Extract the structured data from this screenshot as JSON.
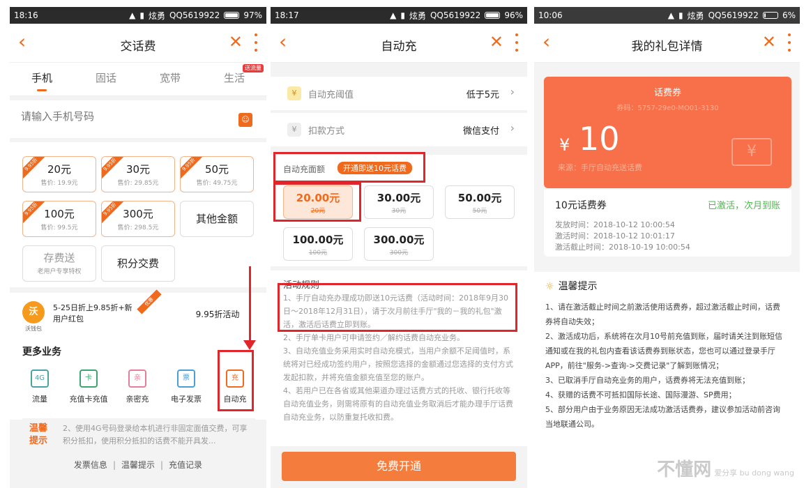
{
  "panel1": {
    "status": {
      "time": "18:16",
      "wifi": "WiFi",
      "signal": "炫勇",
      "carrier": "QQ5619922",
      "battery": "97%",
      "battery_level": 0.97
    },
    "nav": {
      "title": "交话费"
    },
    "tabs": [
      {
        "label": "手机",
        "active": true
      },
      {
        "label": "固话"
      },
      {
        "label": "宽带"
      },
      {
        "label": "生活",
        "flag": "送流量"
      }
    ],
    "phone_input": {
      "placeholder": "请输入手机号码"
    },
    "amounts": [
      {
        "value": "20元",
        "price": "售价: 19.9元",
        "ribbon": "9.95折"
      },
      {
        "value": "30元",
        "price": "售价: 29.85元",
        "ribbon": "9.95折"
      },
      {
        "value": "50元",
        "price": "售价: 49.75元",
        "ribbon": "9.95折"
      },
      {
        "value": "100元",
        "price": "售价: 99.5元",
        "ribbon": "9.95折"
      },
      {
        "value": "300元",
        "price": "售价: 298.5元",
        "ribbon": "9.95折"
      },
      {
        "value": "其他金额"
      },
      {
        "value": "存费送",
        "price": "老用户专享特权"
      },
      {
        "value": "积分交费"
      }
    ],
    "promo": {
      "logo": "沃",
      "logo_caption": "沃钱包",
      "text": "5-25日折上9.85折+新用户红包",
      "tag": "优惠",
      "right_text": "9.95折活动"
    },
    "more_biz": {
      "title": "更多业务",
      "items": [
        {
          "label": "流量",
          "icon": "4G"
        },
        {
          "label": "充值卡充值",
          "icon": "卡"
        },
        {
          "label": "亲密充",
          "icon": "亲"
        },
        {
          "label": "电子发票",
          "icon": "票"
        },
        {
          "label": "自动充",
          "icon": "充"
        }
      ]
    },
    "tip": {
      "badge": "温馨提示",
      "text": "2、使用4G号码登录给本机进行非固定面值交费，可享积分抵扣，使用积分抵扣的话费不能开具发..."
    },
    "footer": [
      "发票信息",
      "温馨提示",
      "充值记录"
    ]
  },
  "panel2": {
    "status": {
      "time": "18:17",
      "wifi": "WiFi",
      "signal": "炫勇",
      "carrier": "QQ5619922",
      "battery": "96%",
      "battery_level": 0.96
    },
    "nav": {
      "title": "自动充"
    },
    "threshold": {
      "label": "自动充阈值",
      "value": "低于5元",
      "icon": "¥"
    },
    "pay": {
      "label": "扣款方式",
      "value": "微信支付",
      "icon": "¥"
    },
    "auto": {
      "label": "自动充面额",
      "tag": "开通即送10元话费"
    },
    "amounts": [
      {
        "value": "20.00元",
        "orig": "20元",
        "selected": true
      },
      {
        "value": "30.00元",
        "orig": "30元"
      },
      {
        "value": "50.00元",
        "orig": "50元"
      },
      {
        "value": "100.00元",
        "orig": "100元"
      },
      {
        "value": "300.00元",
        "orig": "300元"
      }
    ],
    "rules": {
      "title": "活动规则",
      "items": [
        "1、手厅自动充办理成功即送10元话费（活动时间：2018年9月30日～2018年12月31日），请于次月前往手厅\"我的－我的礼包\"激活，激活后话费立即到账。",
        "2、手厅单卡用户可申请签约／解约话费自动充业务。",
        "3、自动充值业务采用实时自动充模式，当用户余额不足阈值时，系统将对已经成功签约用户，按照您选择的金额通过您选择的支付方式发起扣款，并将充值金额充值至您的账户。",
        "4、若用户已在各省或其他渠道办理过话费方式的托收、银行托收等自动充值业务，则需将原有的自动充值业务取消后才能办理手厅话费自动充业务，以防重复托收扣费。"
      ]
    },
    "open_button": "免费开通"
  },
  "panel3": {
    "status": {
      "time": "10:06",
      "wifi": "WiFi",
      "signal": "炫勇",
      "carrier": "QQ5619922",
      "battery": "6%",
      "battery_level": 0.06
    },
    "nav": {
      "title": "我的礼包详情"
    },
    "coupon": {
      "title": "话费券",
      "id": "券码：5757-29e0-MO01-3130",
      "currency": "¥",
      "amount": "10",
      "source": "来源：手厅自动充送话费",
      "stamp": "¥"
    },
    "detail": {
      "name": "10元话费券",
      "status": "已激活，次月到账",
      "issue": "发放时间：2018-10-12 10:00:54",
      "activate": "激活时间：2018-10-12 10:01:17",
      "deadline": "激活截止时间：2018-10-19 10:00:54"
    },
    "tips": {
      "title": "温馨提示",
      "items": [
        "1、请在激活截止时间之前激活使用话费券，超过激活截止时间，话费券将自动失效；",
        "2、激活成功后，系统将在次月10号前充值到账，届时请关注到账短信通知或在我的礼包内查看该话费券到账状态，您也可以通过登录手厅APP，前往\"服务->查询->交费记录\"了解到账情况；",
        "3、已取消手厅自动充业务的用户，话费券将无法充值到账；",
        "4、获赠的话费不可抵扣国际长途、国际漫游、SP费用；",
        "5、部分用户由于业务原因无法成功激活话费券，建议参加活动前咨询当地联通公司。"
      ]
    }
  },
  "watermark": {
    "text": "不懂网",
    "sub": "爱分享 bu dong wang"
  }
}
